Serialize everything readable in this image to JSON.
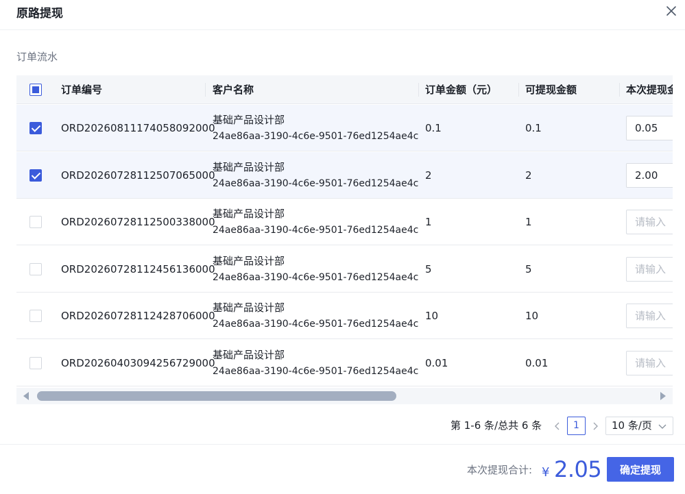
{
  "dialog": {
    "title": "原路提现",
    "close_icon": "close-icon"
  },
  "section": {
    "label": "订单流水"
  },
  "table": {
    "select_all_state": "indeterminate",
    "columns": [
      "订单编号",
      "客户名称",
      "订单金额（元）",
      "可提现金额",
      "本次提现金"
    ],
    "rows": [
      {
        "checked": true,
        "order_no": "ORD20260811174058092000",
        "customer_name": "基础产品设计部",
        "customer_id": "24ae86aa-3190-4c6e-9501-76ed1254ae4c",
        "amount": "0.1",
        "withdrawable": "0.1",
        "withdraw_value": "0.05",
        "placeholder": "请输入"
      },
      {
        "checked": true,
        "order_no": "ORD20260728112507065000",
        "customer_name": "基础产品设计部",
        "customer_id": "24ae86aa-3190-4c6e-9501-76ed1254ae4c",
        "amount": "2",
        "withdrawable": "2",
        "withdraw_value": "2.00",
        "placeholder": "请输入"
      },
      {
        "checked": false,
        "order_no": "ORD20260728112500338000",
        "customer_name": "基础产品设计部",
        "customer_id": "24ae86aa-3190-4c6e-9501-76ed1254ae4c",
        "amount": "1",
        "withdrawable": "1",
        "withdraw_value": "",
        "placeholder": "请输入"
      },
      {
        "checked": false,
        "order_no": "ORD20260728112456136000",
        "customer_name": "基础产品设计部",
        "customer_id": "24ae86aa-3190-4c6e-9501-76ed1254ae4c",
        "amount": "5",
        "withdrawable": "5",
        "withdraw_value": "",
        "placeholder": "请输入"
      },
      {
        "checked": false,
        "order_no": "ORD20260728112428706000",
        "customer_name": "基础产品设计部",
        "customer_id": "24ae86aa-3190-4c6e-9501-76ed1254ae4c",
        "amount": "10",
        "withdrawable": "10",
        "withdraw_value": "",
        "placeholder": "请输入"
      },
      {
        "checked": false,
        "order_no": "ORD20260403094256729000",
        "customer_name": "基础产品设计部",
        "customer_id": "24ae86aa-3190-4c6e-9501-76ed1254ae4c",
        "amount": "0.01",
        "withdrawable": "0.01",
        "withdraw_value": "",
        "placeholder": "请输入"
      }
    ]
  },
  "pagination": {
    "total_text": "第 1-6 条/总共 6 条",
    "current_page": "1",
    "page_size": "10 条/页"
  },
  "footer": {
    "sum_label": "本次提现合计:",
    "currency": "¥",
    "sum_value": "2.05",
    "confirm_label": "确定提现"
  },
  "colors": {
    "accent": "#3b5bdb",
    "button": "#4565e6",
    "selected_row": "#f3f6fd",
    "header_bg": "#f4f6f9"
  }
}
